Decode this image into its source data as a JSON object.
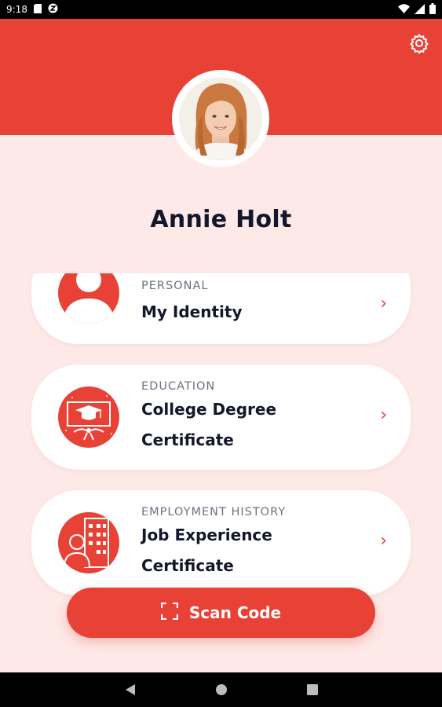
{
  "status_bar": {
    "time": "9:18"
  },
  "profile": {
    "name": "Annie Holt"
  },
  "cards": [
    {
      "category": "PERSONAL",
      "title": "My Identity",
      "chevron": "›",
      "icon": "person-icon"
    },
    {
      "category": "EDUCATION",
      "title": "College Degree\nCertificate",
      "chevron": "›",
      "icon": "graduation-icon"
    },
    {
      "category": "EMPLOYMENT HISTORY",
      "title": "Job Experience\nCertificate",
      "chevron": "›",
      "icon": "building-employee-icon"
    }
  ],
  "scan_button": {
    "label": "Scan Code",
    "icon": "scan-frame-icon"
  },
  "colors": {
    "accent": "#e84236",
    "background": "#fde9e8",
    "text": "#14162b",
    "muted": "#6f7182"
  }
}
